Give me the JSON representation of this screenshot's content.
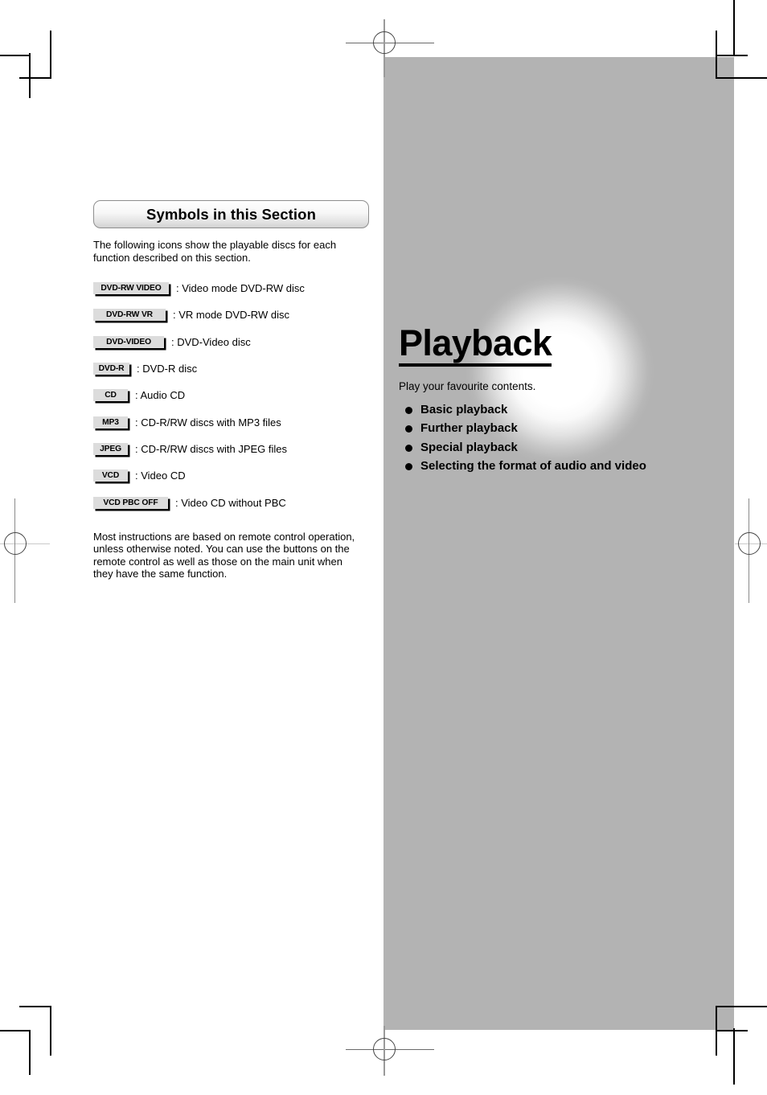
{
  "page": {
    "background_color": "#ffffff",
    "panel_color": "#b3b3b3"
  },
  "left_column": {
    "section_header": "Symbols in this Section",
    "intro_text": "The following icons show the playable discs for each function described on this section.",
    "symbols": [
      {
        "badge": "DVD-RW VIDEO",
        "description": ": Video mode DVD-RW disc"
      },
      {
        "badge": "DVD-RW VR",
        "description": ": VR mode DVD-RW disc"
      },
      {
        "badge": "DVD-VIDEO",
        "description": ": DVD-Video disc"
      },
      {
        "badge": "DVD-R",
        "description": ": DVD-R disc"
      },
      {
        "badge": "CD",
        "description": ": Audio CD"
      },
      {
        "badge": "MP3",
        "description": ": CD-R/RW discs with MP3 files"
      },
      {
        "badge": "JPEG",
        "description": ": CD-R/RW discs with JPEG files"
      },
      {
        "badge": "VCD",
        "description": ": Video CD"
      },
      {
        "badge": "VCD PBC OFF",
        "description": ": Video CD without PBC"
      }
    ],
    "closing_text": "Most instructions are based on remote control operation, unless otherwise noted. You can use the buttons on the remote control as well as those on the main unit when they have the same function."
  },
  "panel": {
    "title": "Playback",
    "subtitle": "Play your favourite contents.",
    "items": [
      "Basic playback",
      "Further playback",
      "Special playback",
      "Selecting the format of audio and video"
    ]
  }
}
